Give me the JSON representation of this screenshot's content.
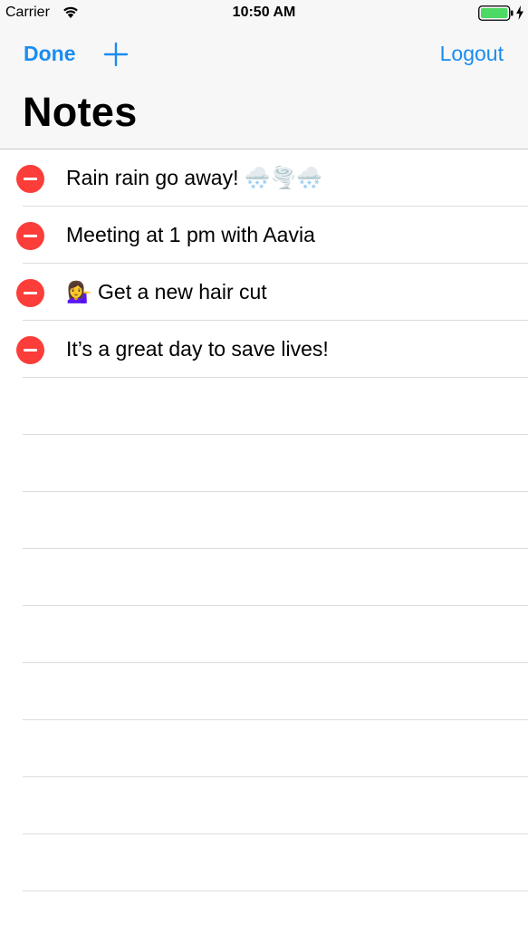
{
  "status_bar": {
    "carrier": "Carrier",
    "time": "10:50 AM",
    "wifi_icon": "wifi-icon",
    "battery_icon": "battery-icon",
    "charging_icon": "charging-bolt-icon"
  },
  "nav": {
    "done_label": "Done",
    "add_icon": "plus-icon",
    "logout_label": "Logout",
    "title": "Notes"
  },
  "notes": [
    {
      "text": "Rain rain go away! 🌨️🌪️🌨️"
    },
    {
      "text": "Meeting at 1 pm with Aavia"
    },
    {
      "text": "💁‍♀️ Get a new hair cut"
    },
    {
      "text": "It’s a great day to save lives!"
    }
  ],
  "colors": {
    "accent": "#1a8cf0",
    "delete": "#fc3d39",
    "bar_background": "#f7f7f7",
    "separator": "#dcdce0",
    "battery": "#4cd964"
  }
}
